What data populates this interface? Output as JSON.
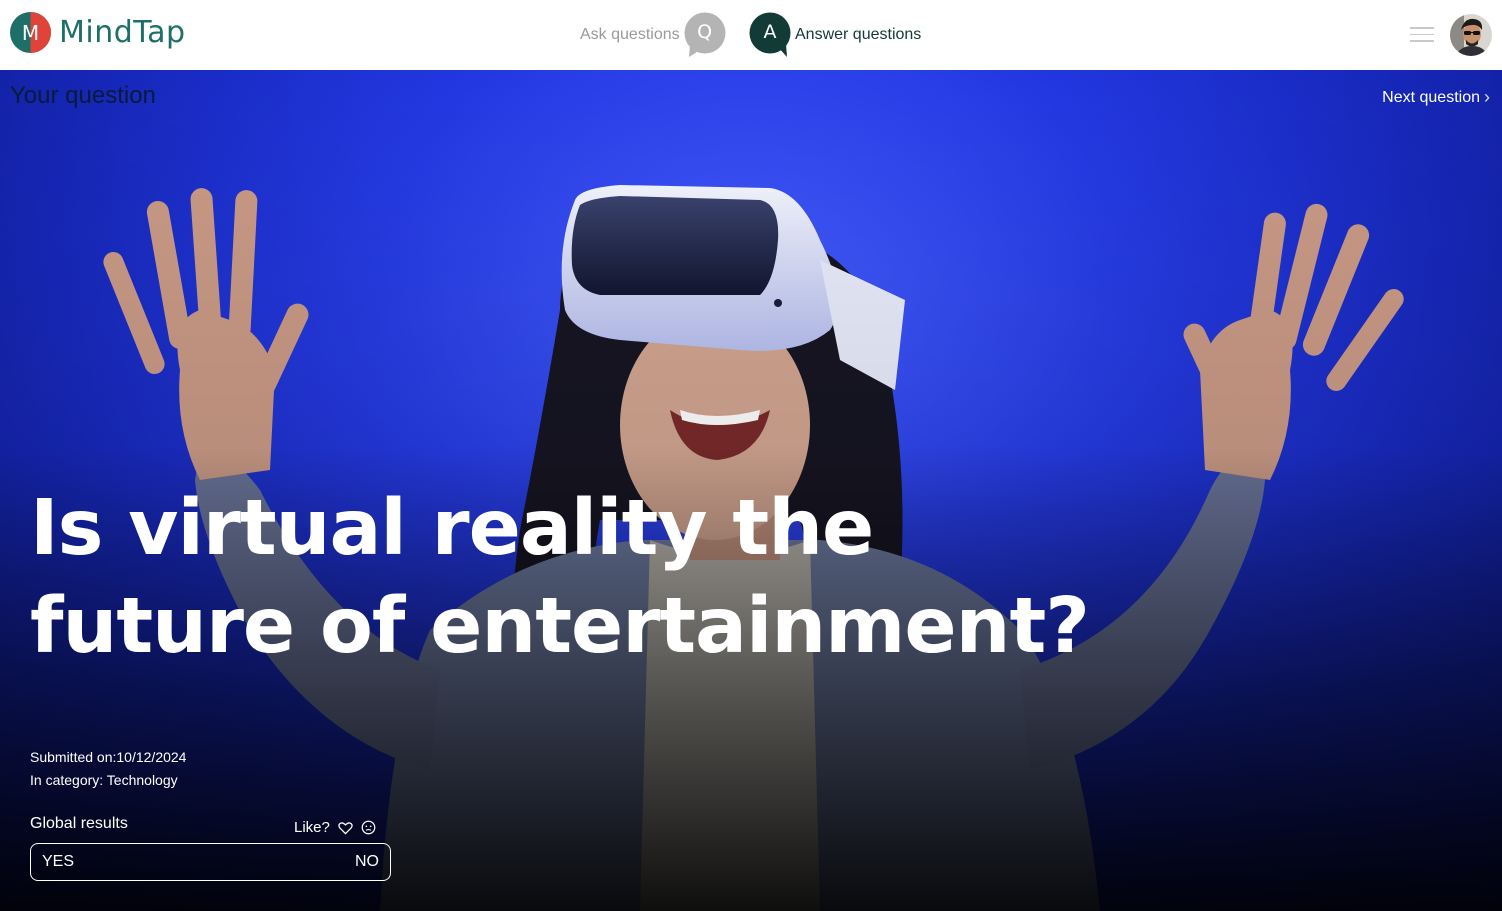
{
  "brand": {
    "name": "MindTap",
    "mark_letter": "M"
  },
  "nav": {
    "ask": {
      "label": "Ask questions",
      "icon_letter": "Q"
    },
    "answer": {
      "label": "Answer questions",
      "icon_letter": "A"
    }
  },
  "hero": {
    "section_label": "Your question",
    "next_label": "Next question",
    "question": "Is virtual reality the future of entertainment?",
    "submitted_label": "Submitted on:",
    "submitted_date": "10/12/2024",
    "category_label": "In category: ",
    "category": "Technology"
  },
  "results": {
    "title": "Global results",
    "like_label": "Like?",
    "yes_label": "YES",
    "no_label": "NO"
  },
  "colors": {
    "brand_teal": "#1d6f68",
    "brand_red": "#e0433a",
    "ask_gray": "#b4b4b4",
    "answer_dark": "#123a37",
    "hero_blue": "#1f34e0"
  },
  "icons": {
    "logo": "mindtap-logo-icon",
    "ask": "question-bubble-icon",
    "answer": "answer-bubble-icon",
    "menu": "hamburger-menu-icon",
    "next": "chevron-right-icon",
    "like": "heart-icon",
    "neutral": "neutral-face-icon"
  }
}
